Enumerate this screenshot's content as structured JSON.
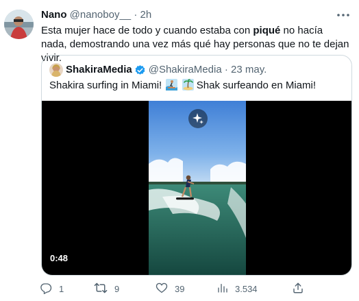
{
  "tweet": {
    "author_name": "Nano",
    "handle": "@nanoboy__",
    "separator": "·",
    "time": "2h",
    "text_before": "Esta mujer hace de todo y cuando estaba con ",
    "text_bold": "piqué",
    "text_after": " no hacía nada, demostrando una vez más qué hay personas que no te dejan vivir."
  },
  "quoted": {
    "author_name": "ShakiraMedia",
    "handle": "@ShakiraMedia",
    "separator": "·",
    "time": "23 may.",
    "text_en": "Shakira surfing in Miami!",
    "text_es": "Shak surfeando en Miami!",
    "video_duration": "0:48"
  },
  "actions": {
    "replies": "1",
    "retweets": "9",
    "likes": "39",
    "views": "3.534"
  },
  "colors": {
    "text": "#0f1419",
    "secondary": "#536471",
    "border": "#cfd9de",
    "verified": "#1d9bf0"
  },
  "icons": [
    "more-icon",
    "verified-icon",
    "sparkle-icon",
    "reply-icon",
    "retweet-icon",
    "like-icon",
    "views-icon",
    "share-icon"
  ]
}
